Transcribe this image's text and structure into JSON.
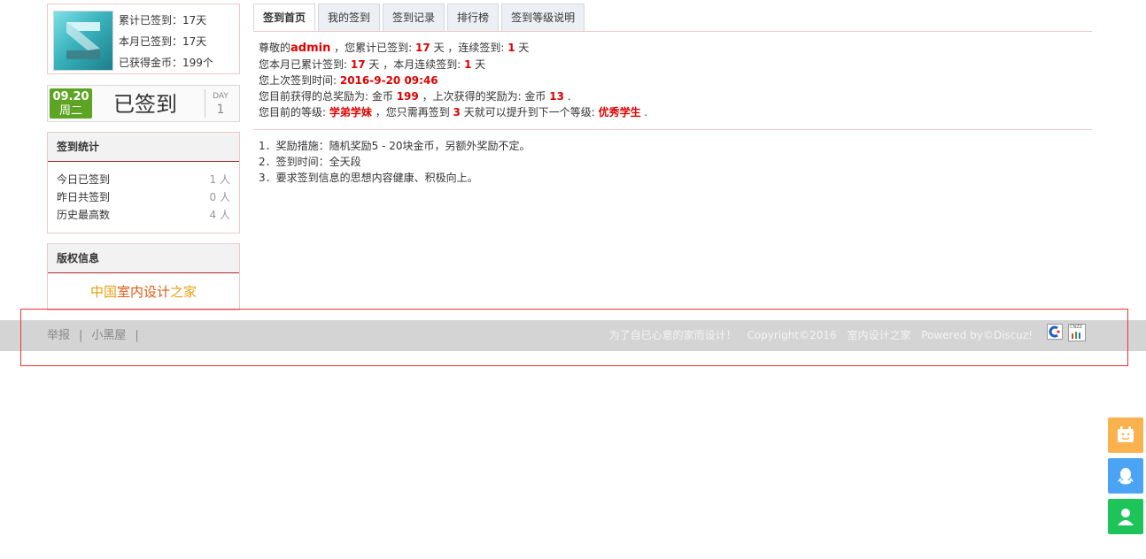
{
  "profile": {
    "total_signed": "累计已签到：17天",
    "month_signed": "本月已签到：17天",
    "coins": "已获得金币：199个"
  },
  "sign_widget": {
    "date": "09.20",
    "weekday": "周二",
    "status": "已签到",
    "day_label": "DAY",
    "day_count": "1"
  },
  "stats": {
    "title": "签到统计",
    "rows": [
      {
        "label": "今日已签到",
        "value": "1 人"
      },
      {
        "label": "昨日共签到",
        "value": "0 人"
      },
      {
        "label": "历史最高数",
        "value": "4 人"
      }
    ]
  },
  "copyright": {
    "title": "版权信息",
    "site_part1": "中国",
    "site_part2": "室内设计",
    "site_part3": "之家"
  },
  "tabs": [
    "签到首页",
    "我的签到",
    "签到记录",
    "排行榜",
    "签到等级说明"
  ],
  "info": {
    "l1a": "尊敬的",
    "user": "admin",
    "l1b": " ，您累计已签到: ",
    "total": "17",
    "l1c": " 天 ，连续签到: ",
    "streak": "1",
    "l1d": " 天",
    "l2a": "您本月已累计签到: ",
    "month": "17",
    "l2b": " 天 ，本月连续签到: ",
    "month_streak": "1",
    "l2c": " 天",
    "l3a": "您上次签到时间: ",
    "last_time": "2016-9-20 09:46",
    "l4a": "您目前获得的总奖励为: 金币 ",
    "reward_total": "199",
    "l4b": " ，上次获得的奖励为: 金币 ",
    "reward_last": "13",
    "l4c": " .",
    "l5a": "您目前的等级: ",
    "level": "学弟学妹",
    "l5b": " ，您只需再签到 ",
    "need_days": "3",
    "l5c": " 天就可以提升到下一个等级: ",
    "next_level": "优秀学生",
    "l5d": " ."
  },
  "rules": [
    "1．奖励措施：随机奖励5 - 20块金币，另额外奖励不定。",
    "2．签到时间：全天段",
    "3．要求签到信息的思想内容健康、积极向上。"
  ],
  "footer": {
    "report": "举报",
    "blackroom": "小黑屋",
    "sep": "|",
    "slogan": "为了自已心意的家而设计！",
    "copyright": "Copyright©2016",
    "site": "室内设计之家",
    "powered": "Powered by©Discuz!",
    "cnzz": "CNZZ"
  },
  "colors": {
    "highlight": "#e00000",
    "badge": "#5da423",
    "footer_bg": "#d4d4d4",
    "float_calendar": "#f9b24d",
    "float_qq": "#4ba4f3",
    "float_contact": "#1dc459"
  },
  "icons": [
    "avatar-3d-logo",
    "calendar-icon",
    "qq-icon",
    "contact-icon",
    "cnzz-stat-icon",
    "chart-stat-icon"
  ]
}
